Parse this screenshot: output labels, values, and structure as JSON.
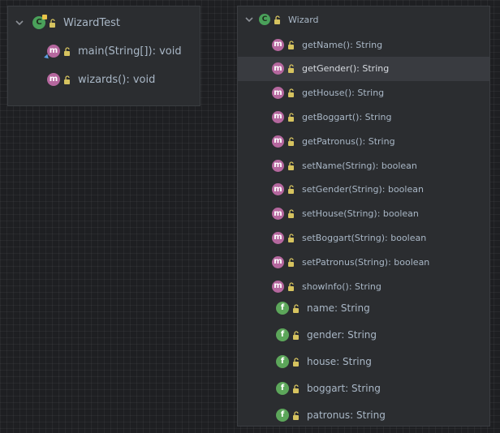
{
  "left_panel": {
    "class_name": "WizardTest",
    "methods": [
      "main(String[]): void",
      "wizards(): void"
    ]
  },
  "right_panel": {
    "class_name": "Wizard",
    "methods": [
      "getName(): String",
      "getGender(): String",
      "getHouse(): String",
      "getBoggart(): String",
      "getPatronus(): String",
      "setName(String): boolean",
      "setGender(String): boolean",
      "setHouse(String): boolean",
      "setBoggart(String): boolean",
      "setPatronus(String): boolean",
      "showInfo(): String"
    ],
    "selected_method": "getGender(): String",
    "fields": [
      "name: String",
      "gender: String",
      "house: String",
      "boggart: String",
      "patronus: String"
    ]
  },
  "icons": {
    "class_badge": "C",
    "method_badge": "m",
    "field_badge": "f",
    "collapse": "chevron-down-icon",
    "lock": "lock-icon"
  },
  "colors": {
    "class_icon": "#4aa15a",
    "method_icon": "#b5679e",
    "field_icon": "#5ca65a",
    "lock": "#d6c35f",
    "selected_row": "#393b40"
  }
}
